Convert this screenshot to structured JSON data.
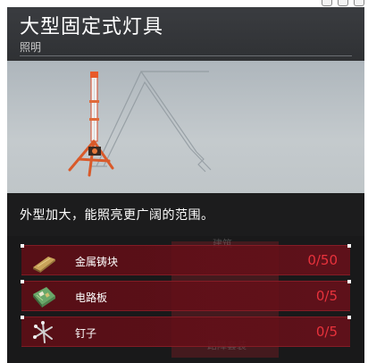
{
  "item": {
    "title": "大型固定式灯具",
    "category": "照明",
    "description": "外型加大，能照亮更广阔的范围。"
  },
  "background_labels": {
    "top": "建筑",
    "bottom": "路障套装"
  },
  "materials": [
    {
      "name": "金属铸块",
      "count": "0/50",
      "icon": "metal-ingot-icon"
    },
    {
      "name": "电路板",
      "count": "0/5",
      "icon": "circuit-board-icon"
    },
    {
      "name": "钉子",
      "count": "0/5",
      "icon": "nails-icon"
    }
  ],
  "colors": {
    "accent_red": "#e8323c",
    "row_bg": "#5c0e16",
    "panel_bg": "#1a1a1b"
  }
}
